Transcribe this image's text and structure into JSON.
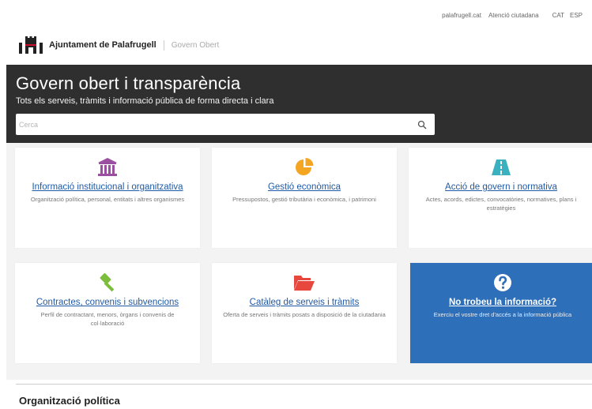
{
  "topbar": {
    "links": [
      "palafrugell.cat",
      "Atenció ciutadana"
    ],
    "languages": [
      "CAT",
      "ESP"
    ]
  },
  "brand": {
    "name": "Ajuntament de Palafrugell",
    "subtitle": "Govern Obert"
  },
  "hero": {
    "title": "Govern obert i transparència",
    "tagline": "Tots els serveis, tràmits i informació pública de forma directa i clara",
    "search_placeholder": "Cerca"
  },
  "cards": [
    {
      "title": "Informació institucional i organitzativa",
      "description": "Organització política, personal, entitats i altres organismes",
      "icon": "institution-building-icon",
      "color": "#9b4fa0"
    },
    {
      "title": "Gestió econòmica",
      "description": "Pressupostos, gestió tributària i econòmica, i patrimoni",
      "icon": "pie-chart-icon",
      "color": "#f4a623"
    },
    {
      "title": "Acció de govern i normativa",
      "description": "Actes, acords, edictes, convocatòries, normatives, plans i estratègies",
      "icon": "road-icon",
      "color": "#3bb1c0"
    },
    {
      "title": "Contractes, convenis i subvencions",
      "description": "Perfil de contractant, menors, òrgans i convenis de col·laboració",
      "icon": "gavel-icon",
      "color": "#7cbd3c"
    },
    {
      "title": "Catàleg de serveis i tràmits",
      "description": "Oferta de serveis i tràmits posats a disposició de la ciutadania",
      "icon": "folder-open-icon",
      "color": "#e8473e"
    },
    {
      "title": "No trobeu la informació?",
      "description": "Exerciu el vostre dret d'accés a la informació pública",
      "icon": "question-circle-icon",
      "color": "#2d6fb8"
    }
  ],
  "section": {
    "title": "Organització política"
  }
}
